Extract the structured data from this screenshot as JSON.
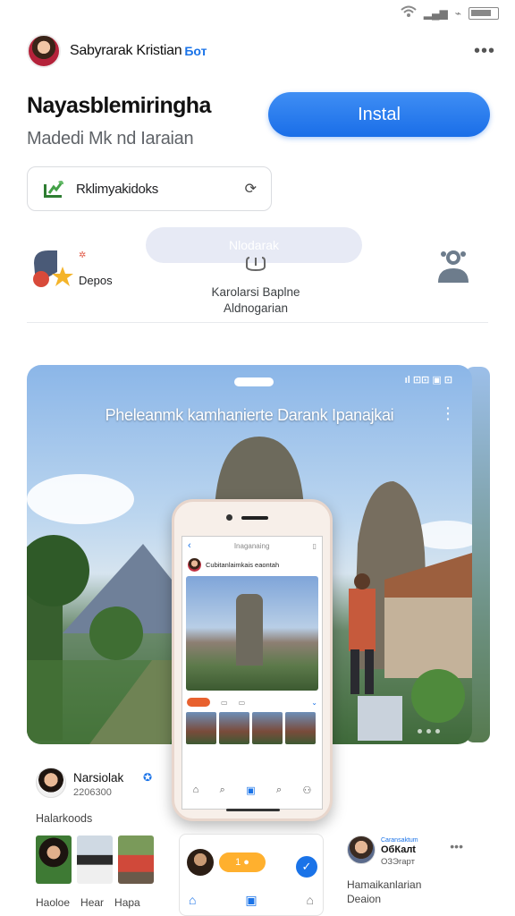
{
  "status_bar": {
    "signal": "▂▄▆",
    "extra": "⌁"
  },
  "developer": {
    "name": "Sabyrarak Kristian",
    "badge": "Бот",
    "menu": "•••"
  },
  "app": {
    "title": "Nayasblemiringha",
    "subtitle": "Madedi Mk nd Iaraian",
    "install_label": "Instal"
  },
  "chip": {
    "label": "Rklimyakidoks",
    "action": "⟳"
  },
  "stats": {
    "pill_text": "Nlodarak",
    "left_label": "Depos",
    "middle_line1": "Karolarsi Baplne",
    "middle_line2": "Aldnogarian"
  },
  "hero": {
    "status": "ıl ⊡⊡ ▣ ⊡",
    "caption": "Pheleanmk kamhanierte Darank Ipanajkai",
    "menu": "⋮"
  },
  "phone_screen": {
    "header_title": "Inaganaing",
    "user_line": "Cubitanlaimkais eaontah",
    "nav": [
      "⌂",
      "⌕",
      "▣",
      "⌕",
      "⚇"
    ]
  },
  "card_left": {
    "name": "Narsiolak",
    "sub": "2206300",
    "section": "Halarkoods",
    "captions": [
      "Haoloe",
      "Hear",
      "Hapa"
    ]
  },
  "card_mid": {
    "badge": "1 ●",
    "nav": [
      "⌂",
      "▣",
      "⌂"
    ]
  },
  "card_right": {
    "tag": "Caransaktum",
    "name": "ОбКалt",
    "sub": "ОЗЭгарт",
    "more": "•••",
    "line1": "Hamaikanlarian",
    "line2": "Deaion"
  },
  "colors": {
    "accent": "#1a73e8",
    "install_blue": "#2b7cf0",
    "orange": "#ffb02e"
  }
}
